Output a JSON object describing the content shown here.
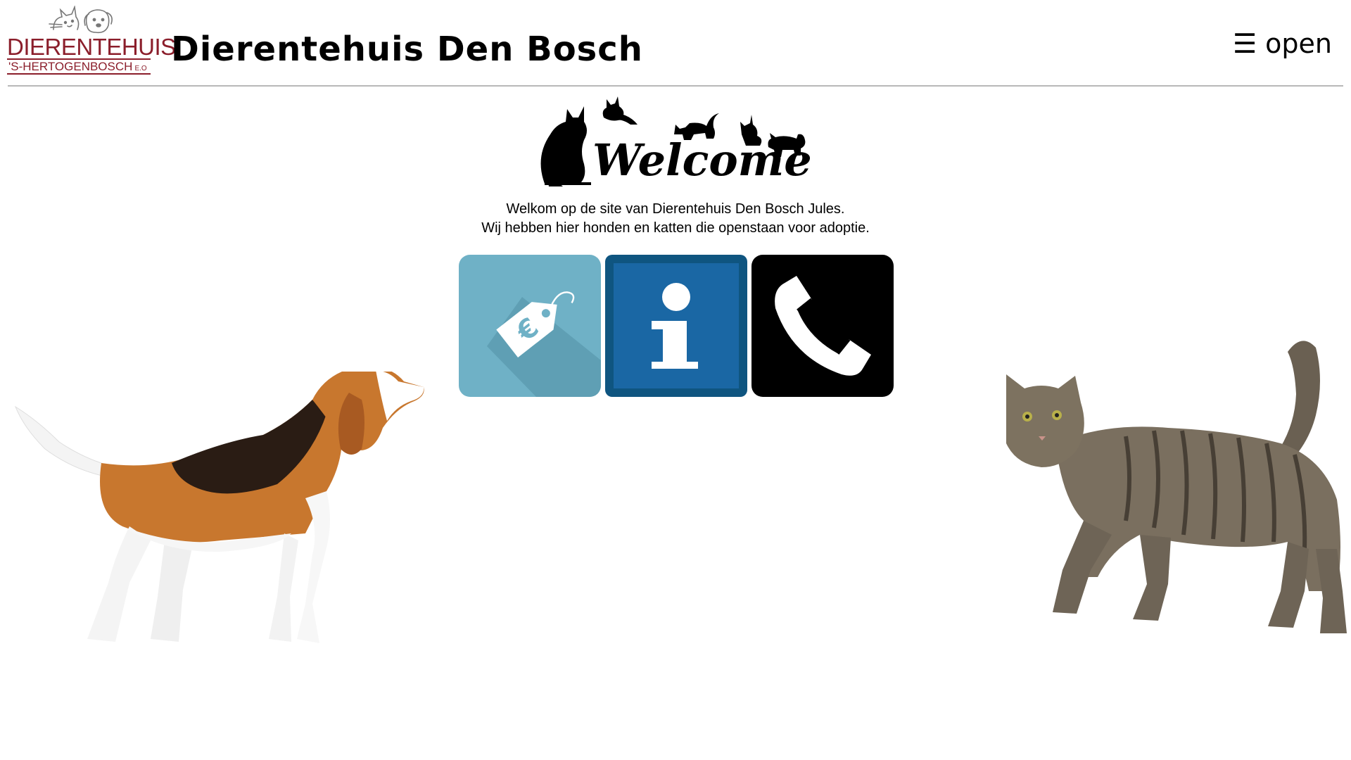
{
  "header": {
    "logo": {
      "line1": "DIERENTEHUIS",
      "line2": "'S-HERTOGENBOSCH",
      "line2_suffix": "E.O",
      "color": "#8b1e2b"
    },
    "title": "Dierentehuis Den Bosch",
    "menu_toggle": "☰ open"
  },
  "welcome": {
    "art_text": "Welcome",
    "intro_line1": "Welkom op de site van Dierentehuis Den Bosch Jules.",
    "intro_line2": "Wij hebben hier honden en katten die openstaan voor adoptie."
  },
  "tiles": [
    {
      "icon": "price-tag-euro-icon",
      "symbol": "€",
      "color": "#6fb1c6"
    },
    {
      "icon": "info-icon",
      "color": "#1a67a4"
    },
    {
      "icon": "phone-icon",
      "color": "#000000"
    }
  ]
}
